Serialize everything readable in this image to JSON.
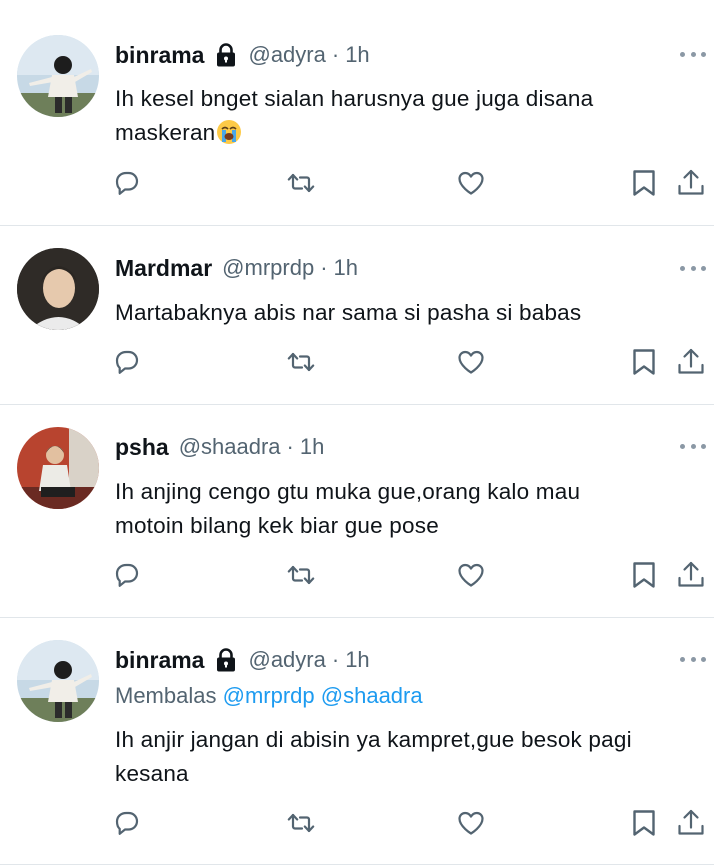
{
  "tweets": [
    {
      "name": "binrama",
      "locked": true,
      "handle": "@adyra",
      "separator": "·",
      "time": "1h",
      "text": "Ih kesel bnget sialan harusnya gue juga disana maskeran",
      "text_line1": "Ih kesel bnget sialan harusnya gue juga disana",
      "text_line2": "maskeran",
      "emoji": "loudly-crying-face"
    },
    {
      "name": "Mardmar",
      "locked": false,
      "handle": "@mrprdp",
      "separator": "·",
      "time": "1h",
      "text": "Martabaknya abis nar sama si pasha si babas"
    },
    {
      "name": "psha",
      "locked": false,
      "handle": "@shaadra",
      "separator": "·",
      "time": "1h",
      "text_line1": "Ih anjing cengo gtu muka gue,orang kalo mau",
      "text_line2": "motoin bilang kek biar gue pose"
    },
    {
      "name": "binrama",
      "locked": true,
      "handle": "@adyra",
      "separator": "·",
      "time": "1h",
      "reply_prefix": "Membalas",
      "reply_mentions": [
        "@mrprdp",
        "@shaadra"
      ],
      "text_line1": "Ih anjir jangan di abisin ya kampret,gue besok pagi",
      "text_line2": "kesana"
    }
  ],
  "actions": [
    "reply-icon",
    "retweet-icon",
    "like-icon",
    "bookmark-icon",
    "share-icon"
  ],
  "colors": {
    "text": "#0f1419",
    "secondary": "#536471",
    "mention": "#1d9bf0",
    "divider": "#e1e6ea",
    "icon": "#536471"
  }
}
